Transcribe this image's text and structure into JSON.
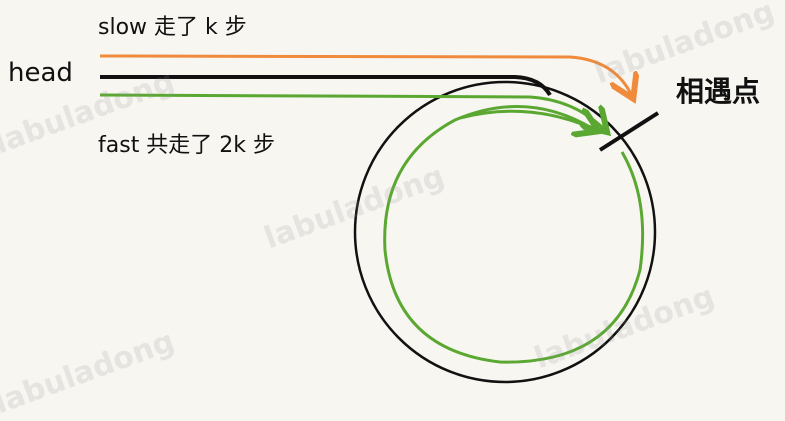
{
  "labels": {
    "slow": "slow 走了 k 步",
    "head": "head",
    "fast": "fast 共走了 2k 步",
    "meet": "相遇点"
  },
  "watermark": "labuladong",
  "colors": {
    "slow": "#f08a3c",
    "fast": "#5aa832",
    "list": "#111111",
    "background": "#f8f6f1"
  }
}
